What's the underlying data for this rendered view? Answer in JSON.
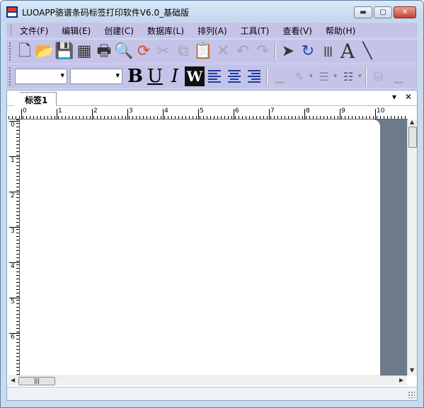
{
  "window": {
    "title": "LUOAPP骆谱条码标签打印软件V6.0_基础版",
    "minimize_glyph": "▬",
    "maximize_glyph": "▢",
    "close_glyph": "✕"
  },
  "menu": {
    "items": [
      "文件(F)",
      "编辑(E)",
      "创建(C)",
      "数据库(L)",
      "排列(A)",
      "工具(T)",
      "查看(V)",
      "帮助(H)"
    ]
  },
  "toolbar_main": {
    "buttons": [
      {
        "name": "new-file-icon",
        "glyph": "🗋",
        "enabled": true
      },
      {
        "name": "open-folder-icon",
        "glyph": "📂",
        "enabled": true
      },
      {
        "name": "save-icon",
        "glyph": "💾",
        "enabled": true
      },
      {
        "name": "page-setup-icon",
        "glyph": "▦",
        "enabled": true
      },
      {
        "name": "print-icon",
        "glyph": "🖶",
        "enabled": true
      },
      {
        "name": "print-preview-icon",
        "glyph": "🔍",
        "enabled": true
      },
      {
        "name": "refresh-data-icon",
        "glyph": "⟳",
        "enabled": true
      },
      {
        "name": "cut-icon",
        "glyph": "✂",
        "enabled": false
      },
      {
        "name": "copy-icon",
        "glyph": "⧉",
        "enabled": false
      },
      {
        "name": "paste-icon",
        "glyph": "📋",
        "enabled": true
      },
      {
        "name": "delete-icon",
        "glyph": "✕",
        "enabled": false
      },
      {
        "name": "undo-icon",
        "glyph": "↶",
        "enabled": false
      },
      {
        "name": "redo-icon",
        "glyph": "↷",
        "enabled": false
      },
      {
        "name": "select-pointer-icon",
        "glyph": "➤",
        "enabled": true
      },
      {
        "name": "rotate-icon",
        "glyph": "↻",
        "enabled": true
      },
      {
        "name": "barcode-icon",
        "glyph": "|||",
        "enabled": true
      },
      {
        "name": "text-tool-icon",
        "glyph": "A",
        "enabled": true
      },
      {
        "name": "line-tool-icon",
        "glyph": "╲",
        "enabled": true
      }
    ]
  },
  "toolbar_format": {
    "font_name": "",
    "font_size": "",
    "bold_glyph": "B",
    "underline_glyph": "U",
    "italic_glyph": "I",
    "wrap_glyph": "W"
  },
  "document_tab": {
    "label": "标签1",
    "menu_glyph": "▾",
    "close_glyph": "✕"
  },
  "ruler": {
    "h_labels": [
      "0",
      "1",
      "2",
      "3",
      "4",
      "5",
      "6",
      "7",
      "8",
      "9",
      "10"
    ],
    "v_labels": [
      "0",
      "1",
      "2",
      "3",
      "4",
      "5",
      "6"
    ]
  },
  "scroll": {
    "up_glyph": "▲",
    "down_glyph": "▼",
    "left_glyph": "◀",
    "right_glyph": "▶",
    "grip_glyph": "|||"
  },
  "colors": {
    "menubar_bg": "#c6c3e9",
    "canvas_bg": "#6d7a88",
    "label_bg": "#ffffff"
  }
}
